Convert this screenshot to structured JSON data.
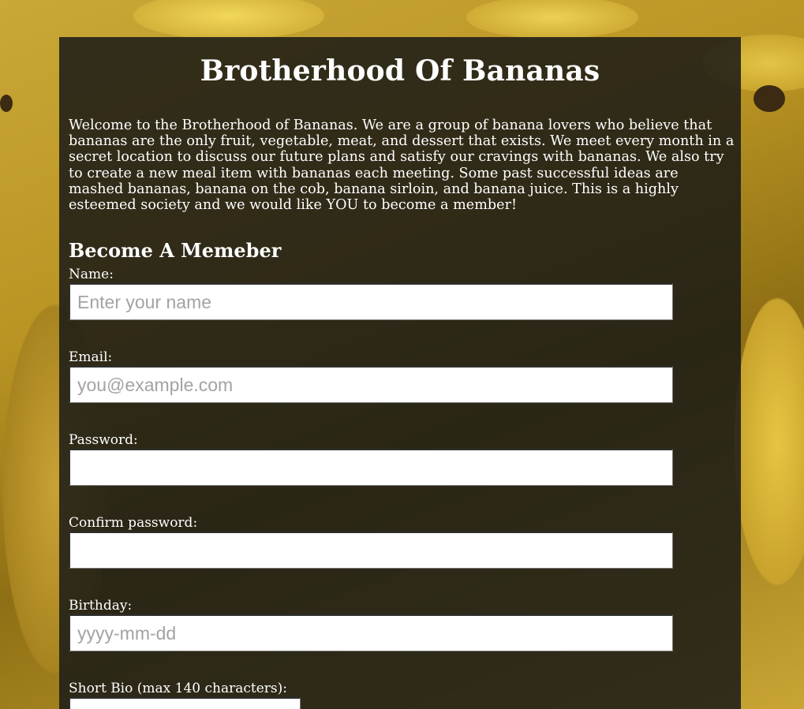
{
  "page": {
    "title": "Brotherhood Of Bananas",
    "intro": "Welcome to the Brotherhood of Bananas. We are a group of banana lovers who believe that bananas are the only fruit, vegetable, meat, and dessert that exists. We meet every month in a secret location to discuss our future plans and satisfy our cravings with bananas. We also try to create a new meal item with bananas each meeting. Some past successful ideas are mashed bananas, banana on the cob, banana sirloin, and banana juice. This is a highly esteemed society and we would like YOU to become a member!"
  },
  "form": {
    "heading": "Become A Memeber",
    "name": {
      "label": "Name:",
      "placeholder": "Enter your name",
      "value": ""
    },
    "email": {
      "label": "Email:",
      "placeholder": "you@example.com",
      "value": ""
    },
    "password": {
      "label": "Password:",
      "placeholder": "",
      "value": ""
    },
    "confirm_password": {
      "label": "Confirm password:",
      "placeholder": "",
      "value": ""
    },
    "birthday": {
      "label": "Birthday:",
      "placeholder": "yyyy-mm-dd",
      "value": ""
    },
    "bio": {
      "label": "Short Bio (max 140 characters):",
      "value": ""
    }
  },
  "colors": {
    "panel_bg": "#1a1a16",
    "text": "#ffffff",
    "input_bg": "#ffffff",
    "placeholder": "#a3a3a3",
    "background_accent": "#d9b533"
  }
}
